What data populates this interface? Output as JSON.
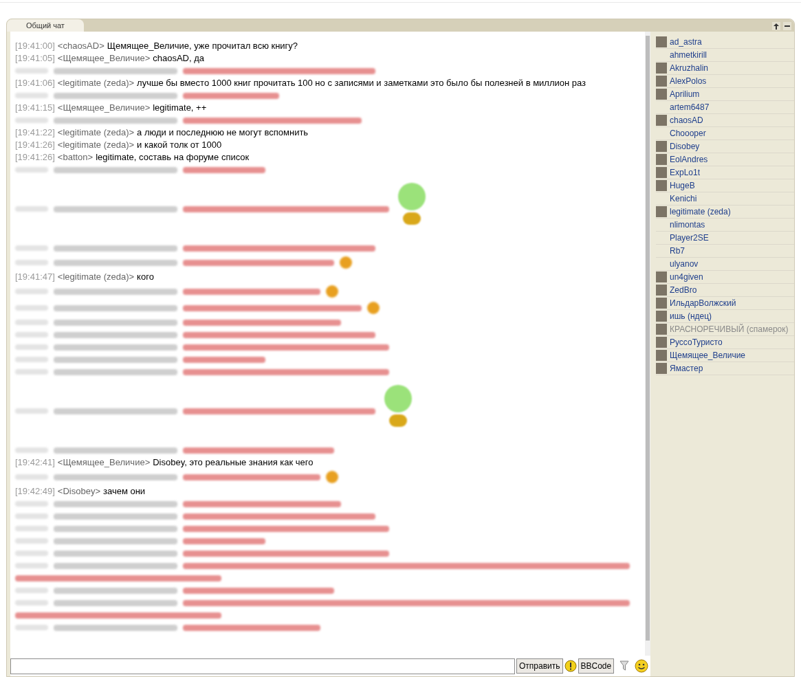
{
  "tab": {
    "label": "Общий чат",
    "selected": true
  },
  "messages": [
    {
      "kind": "text",
      "time": "[19:41:00]",
      "nick": "<chaosAD>",
      "text": "Щемящее_Величие, уже прочитал всю книгу?"
    },
    {
      "kind": "text",
      "time": "[19:41:05]",
      "nick": "<Щемящее_Величие>",
      "text": "chaosAD, да"
    },
    {
      "kind": "blurred"
    },
    {
      "kind": "text",
      "time": "[19:41:06]",
      "nick": "<legitimate (zeda)>",
      "text": "лучше бы вместо 1000 книг прочитать 100 но с записями и заметками это было бы полезней в миллион раз"
    },
    {
      "kind": "blurred"
    },
    {
      "kind": "text",
      "time": "[19:41:15]",
      "nick": "<Щемящее_Величие>",
      "text": "legitimate, ++"
    },
    {
      "kind": "blurred"
    },
    {
      "kind": "text",
      "time": "[19:41:22]",
      "nick": "<legitimate (zeda)>",
      "text": "а люди и последнюю не могут вспомнить"
    },
    {
      "kind": "text",
      "time": "[19:41:26]",
      "nick": "<legitimate (zeda)>",
      "text": "и какой толк от 1000"
    },
    {
      "kind": "text",
      "time": "[19:41:26]",
      "nick": "<batton>",
      "text": "legitimate, составь на форуме список"
    },
    {
      "kind": "blurred"
    },
    {
      "kind": "blurred-image"
    },
    {
      "kind": "blurred"
    },
    {
      "kind": "blurred-emoji"
    },
    {
      "kind": "text",
      "time": "[19:41:47]",
      "nick": "<legitimate (zeda)>",
      "text": "кого"
    },
    {
      "kind": "blurred-emoji"
    },
    {
      "kind": "blurred-emoji"
    },
    {
      "kind": "blurred"
    },
    {
      "kind": "blurred"
    },
    {
      "kind": "blurred"
    },
    {
      "kind": "blurred"
    },
    {
      "kind": "blurred"
    },
    {
      "kind": "blurred-image"
    },
    {
      "kind": "blurred"
    },
    {
      "kind": "text",
      "time": "[19:42:41]",
      "nick": "<Щемящее_Величие>",
      "text": "Disobey, это реальные знания как чего"
    },
    {
      "kind": "blurred-emoji"
    },
    {
      "kind": "text",
      "time": "[19:42:49]",
      "nick": "<Disobey>",
      "text": "зачем они"
    },
    {
      "kind": "blurred"
    },
    {
      "kind": "blurred"
    },
    {
      "kind": "blurred"
    },
    {
      "kind": "blurred"
    },
    {
      "kind": "blurred"
    },
    {
      "kind": "blurred-wrapped"
    },
    {
      "kind": "blurred"
    },
    {
      "kind": "blurred-wrapped"
    },
    {
      "kind": "blurred"
    }
  ],
  "users": [
    {
      "name": "ad_astra",
      "avatar": true,
      "greyed": false
    },
    {
      "name": "ahmetkirill",
      "avatar": false,
      "greyed": false
    },
    {
      "name": "Akruzhalin",
      "avatar": true,
      "greyed": false
    },
    {
      "name": "AlexPolos",
      "avatar": true,
      "greyed": false
    },
    {
      "name": "Aprilium",
      "avatar": true,
      "greyed": false
    },
    {
      "name": "artem6487",
      "avatar": false,
      "greyed": false
    },
    {
      "name": "chaosAD",
      "avatar": true,
      "greyed": false
    },
    {
      "name": "Choooper",
      "avatar": false,
      "greyed": false
    },
    {
      "name": "Disobey",
      "avatar": true,
      "greyed": false
    },
    {
      "name": "EolAndres",
      "avatar": true,
      "greyed": false
    },
    {
      "name": "ExpLo1t",
      "avatar": true,
      "greyed": false
    },
    {
      "name": "HugeB",
      "avatar": true,
      "greyed": false
    },
    {
      "name": "Kenichi",
      "avatar": false,
      "greyed": false
    },
    {
      "name": "legitimate (zeda)",
      "avatar": true,
      "greyed": false
    },
    {
      "name": "nlimontas",
      "avatar": false,
      "greyed": false
    },
    {
      "name": "Player2SE",
      "avatar": false,
      "greyed": false
    },
    {
      "name": "Rb7",
      "avatar": false,
      "greyed": false
    },
    {
      "name": "ulyanov",
      "avatar": false,
      "greyed": false
    },
    {
      "name": "un4given",
      "avatar": true,
      "greyed": false
    },
    {
      "name": "ZedBro",
      "avatar": true,
      "greyed": false
    },
    {
      "name": "ИльдарВолжский",
      "avatar": true,
      "greyed": false
    },
    {
      "name": "ишь (ндец)",
      "avatar": true,
      "greyed": false
    },
    {
      "name": "КРАСНОРЕЧИВЫЙ (спамерок)",
      "avatar": true,
      "greyed": true
    },
    {
      "name": "РуссоТуристо",
      "avatar": true,
      "greyed": false
    },
    {
      "name": "Щемящее_Величие",
      "avatar": true,
      "greyed": false
    },
    {
      "name": "Ямастер",
      "avatar": true,
      "greyed": false
    }
  ],
  "buttons": [
    "Отправить",
    "BBCode"
  ]
}
